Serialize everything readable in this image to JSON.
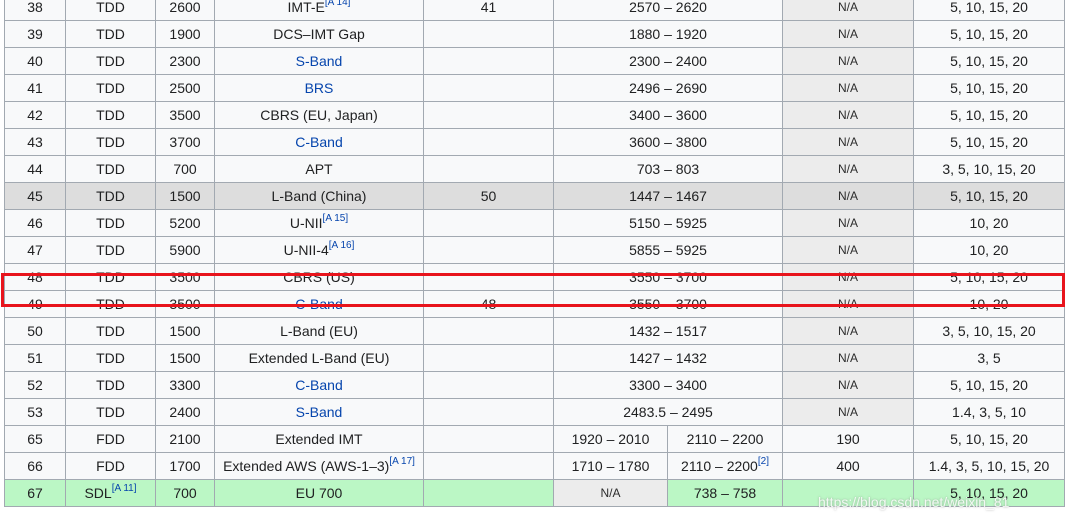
{
  "rows": [
    {
      "band": "38",
      "duplex": "TDD",
      "freq": "2600",
      "name": "IMT-E",
      "name_link": false,
      "name_ref": "[A 14]",
      "subset": "41",
      "range": "2570 – 2620",
      "na": "N/A",
      "bw": "5, 10, 15, 20"
    },
    {
      "band": "39",
      "duplex": "TDD",
      "freq": "1900",
      "name": "DCS–IMT Gap",
      "name_link": false,
      "name_ref": "",
      "subset": "",
      "range": "1880 – 1920",
      "na": "N/A",
      "bw": "5, 10, 15, 20"
    },
    {
      "band": "40",
      "duplex": "TDD",
      "freq": "2300",
      "name": "S-Band",
      "name_link": true,
      "name_ref": "",
      "subset": "",
      "range": "2300 – 2400",
      "na": "N/A",
      "bw": "5, 10, 15, 20"
    },
    {
      "band": "41",
      "duplex": "TDD",
      "freq": "2500",
      "name": "BRS",
      "name_link": true,
      "name_ref": "",
      "subset": "",
      "range": "2496 – 2690",
      "na": "N/A",
      "bw": "5, 10, 15, 20"
    },
    {
      "band": "42",
      "duplex": "TDD",
      "freq": "3500",
      "name": "CBRS (EU, Japan)",
      "name_link": false,
      "name_ref": "",
      "subset": "",
      "range": "3400 – 3600",
      "na": "N/A",
      "bw": "5, 10, 15, 20"
    },
    {
      "band": "43",
      "duplex": "TDD",
      "freq": "3700",
      "name": "C-Band",
      "name_link": true,
      "name_ref": "",
      "subset": "",
      "range": "3600 – 3800",
      "na": "N/A",
      "bw": "5, 10, 15, 20"
    },
    {
      "band": "44",
      "duplex": "TDD",
      "freq": "700",
      "name": "APT",
      "name_link": false,
      "name_ref": "",
      "subset": "",
      "range": "703 – 803",
      "na": "N/A",
      "bw": "3, 5, 10, 15, 20"
    },
    {
      "band": "45",
      "duplex": "TDD",
      "freq": "1500",
      "name": "L-Band (China)",
      "name_link": false,
      "name_ref": "",
      "subset": "50",
      "range": "1447 – 1467",
      "na": "N/A",
      "bw": "5, 10, 15, 20"
    },
    {
      "band": "46",
      "duplex": "TDD",
      "freq": "5200",
      "name": "U-NII",
      "name_link": false,
      "name_ref": "[A 15]",
      "subset": "",
      "range": "5150 – 5925",
      "na": "N/A",
      "bw": "10, 20"
    },
    {
      "band": "47",
      "duplex": "TDD",
      "freq": "5900",
      "name": "U-NII-4",
      "name_link": false,
      "name_ref": "[A 16]",
      "subset": "",
      "range": "5855 – 5925",
      "na": "N/A",
      "bw": "10, 20"
    },
    {
      "band": "48",
      "duplex": "TDD",
      "freq": "3500",
      "name": "CBRS (US)",
      "name_link": false,
      "name_ref": "",
      "subset": "",
      "range": "3550 – 3700",
      "na": "N/A",
      "bw": "5, 10, 15, 20"
    },
    {
      "band": "49",
      "duplex": "TDD",
      "freq": "3500",
      "name": "C-Band",
      "name_link": true,
      "name_ref": "",
      "subset": "48",
      "range": "3550 – 3700",
      "na": "N/A",
      "bw": "10, 20"
    },
    {
      "band": "50",
      "duplex": "TDD",
      "freq": "1500",
      "name": "L-Band (EU)",
      "name_link": false,
      "name_ref": "",
      "subset": "",
      "range": "1432 – 1517",
      "na": "N/A",
      "bw": "3, 5, 10, 15, 20"
    },
    {
      "band": "51",
      "duplex": "TDD",
      "freq": "1500",
      "name": "Extended L-Band (EU)",
      "name_link": false,
      "name_ref": "",
      "subset": "",
      "range": "1427 – 1432",
      "na": "N/A",
      "bw": "3, 5"
    },
    {
      "band": "52",
      "duplex": "TDD",
      "freq": "3300",
      "name": "C-Band",
      "name_link": true,
      "name_ref": "",
      "subset": "",
      "range": "3300 – 3400",
      "na": "N/A",
      "bw": "5, 10, 15, 20"
    },
    {
      "band": "53",
      "duplex": "TDD",
      "freq": "2400",
      "name": "S-Band",
      "name_link": true,
      "name_ref": "",
      "subset": "",
      "range": "2483.5 – 2495",
      "na": "N/A",
      "bw": "1.4, 3, 5, 10"
    },
    {
      "band": "65",
      "duplex": "FDD",
      "freq": "2100",
      "name": "Extended IMT",
      "name_link": false,
      "name_ref": "",
      "subset": "",
      "ul": "1920 – 2010",
      "dl": "2110 – 2200",
      "dl_ref": "",
      "spacing": "190",
      "bw": "5, 10, 15, 20"
    },
    {
      "band": "66",
      "duplex": "FDD",
      "freq": "1700",
      "name": "Extended AWS (AWS-1–3)",
      "name_link": false,
      "name_ref": "[A 17]",
      "subset": "",
      "ul": "1710 – 1780",
      "dl": "2110 – 2200",
      "dl_ref": "[2]",
      "spacing": "400",
      "bw": "1.4, 3, 5, 10, 15, 20"
    },
    {
      "band": "67",
      "duplex": "SDL",
      "duplex_ref": "[A 11]",
      "freq": "700",
      "name": "EU 700",
      "name_link": false,
      "name_ref": "",
      "subset": "",
      "ul_na": "N/A",
      "dl": "738 – 758",
      "dl_ref": "",
      "spacing": "",
      "bw": "5, 10, 15, 20"
    }
  ],
  "watermark": "https://blog.csdn.net/weixin_81"
}
